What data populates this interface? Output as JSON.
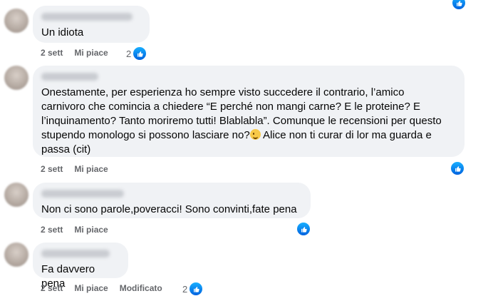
{
  "comments": [
    {
      "text": "Un idiota",
      "time": "2 sett",
      "like_label": "Mi piace",
      "reactions": "2"
    },
    {
      "text_before_emoji": "Onestamente, per esperienza ho sempre visto succedere il contrario, l’amico\ncarnivoro che comincia a chiedere “E perché non mangi carne? E le proteine? E\nl’inquinamento? Tanto moriremo tutti! Blablabla”. Comunque le recensioni per questo\nstupendo monologo si possono lasciare no?",
      "text_after_emoji": " Alice non ti curar di lor ma guarda e\npassa (cit)",
      "emoji": "winking-face",
      "time": "2 sett",
      "like_label": "Mi piace"
    },
    {
      "text": "Non ci sono parole,poveracci! Sono convinti,fate pena",
      "time": "2 sett",
      "like_label": "Mi piace"
    },
    {
      "text": "Fa davvero pena",
      "time": "2 sett",
      "like_label": "Mi piace",
      "edited_label": "Modificato",
      "reactions": "2"
    }
  ],
  "colors": {
    "bubble": "#f0f2f5",
    "like_blue": "#0866ff",
    "meta_gray": "#65676b"
  }
}
